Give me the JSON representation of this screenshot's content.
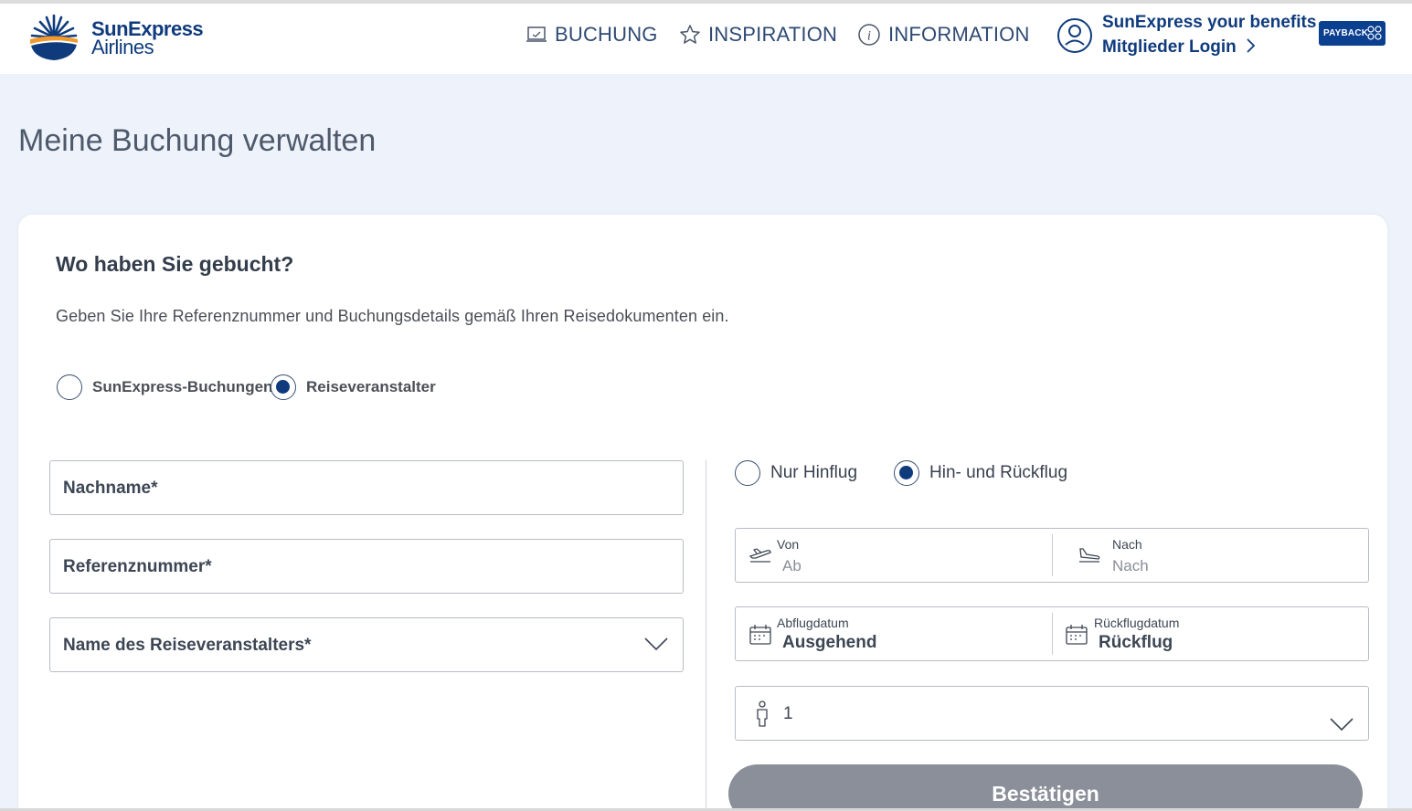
{
  "header": {
    "logo": {
      "line1": "SunExpress",
      "line2": "Airlines"
    },
    "nav": [
      {
        "label": "BUCHUNG",
        "icon": "laptop-icon"
      },
      {
        "label": "INSPIRATION",
        "icon": "star-icon"
      },
      {
        "label": "INFORMATION",
        "icon": "info-icon"
      }
    ],
    "benefits": {
      "line1": "SunExpress your benefits",
      "line2": "Mitglieder Login"
    },
    "payback": "PAYBACK"
  },
  "page": {
    "title": "Meine Buchung verwalten"
  },
  "form": {
    "question": "Wo haben Sie gebucht?",
    "description": "Geben Sie Ihre Referenznummer und Buchungsdetails gemäß Ihren Reisedokumenten ein.",
    "booking_type": {
      "options": [
        "SunExpress-Buchungen",
        "Reiseveranstalter"
      ],
      "selected": "Reiseveranstalter"
    },
    "fields": {
      "nachname": "Nachname*",
      "referenz": "Referenznummer*",
      "operator": "Name des Reiseveranstalters*"
    },
    "trip_type": {
      "options": [
        "Nur Hinflug",
        "Hin- und Rückflug"
      ],
      "selected": "Hin- und Rückflug"
    },
    "route": {
      "from_label": "Von",
      "from_placeholder": "Ab",
      "to_label": "Nach",
      "to_placeholder": "Nach"
    },
    "dates": {
      "depart_label": "Abflugdatum",
      "depart_value": "Ausgehend",
      "return_label": "Rückflugdatum",
      "return_value": "Rückflug"
    },
    "passengers": "1",
    "confirm_label": "Bestätigen"
  },
  "colors": {
    "brand": "#0f3b7d",
    "background": "#eef3fb",
    "button_disabled": "#8a8f99"
  }
}
